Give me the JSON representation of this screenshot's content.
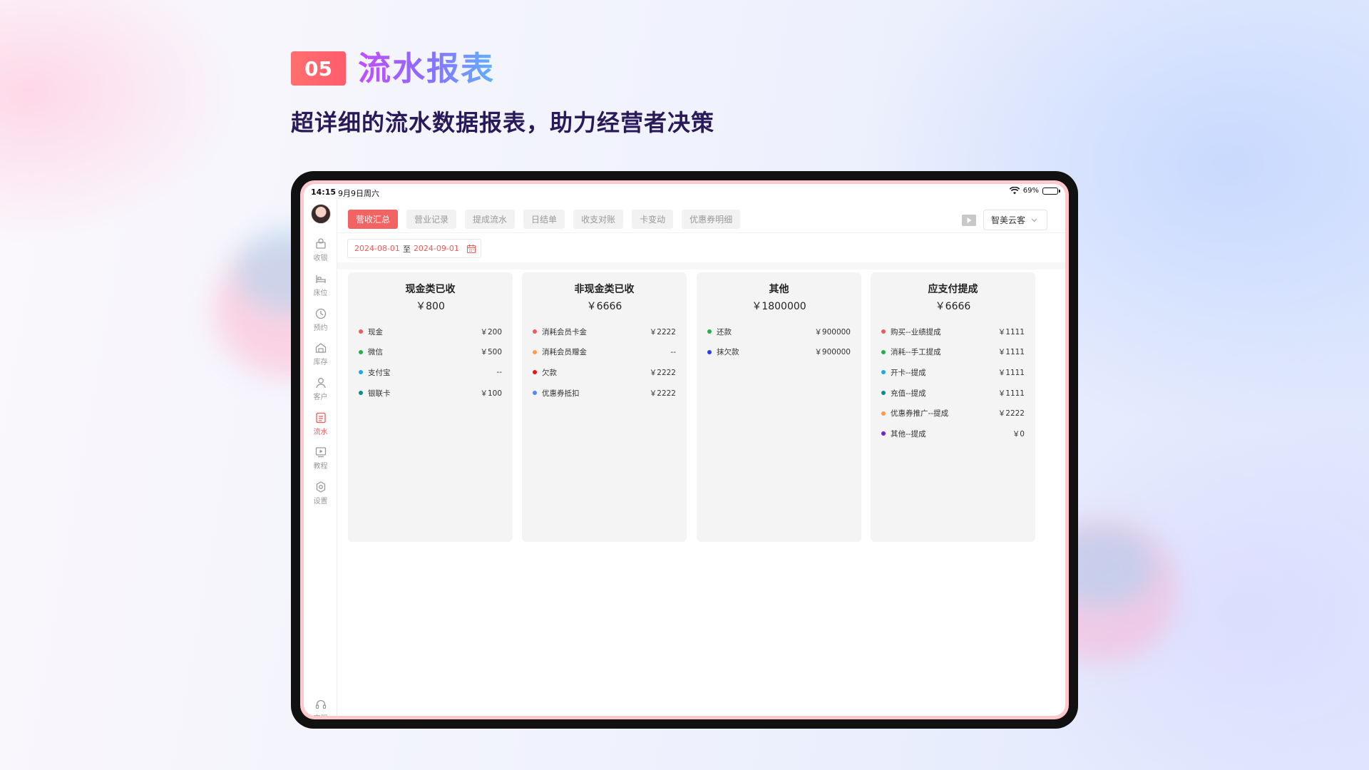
{
  "header": {
    "badge_number": "05",
    "title": "流水报表",
    "subtitle": "超详细的流水数据报表，助力经营者决策"
  },
  "status_bar": {
    "time": "14:15",
    "date": "9月9日周六",
    "battery": "69%"
  },
  "sidebar": {
    "items": [
      {
        "label": "收银",
        "icon": "cashier-icon"
      },
      {
        "label": "床位",
        "icon": "bed-icon"
      },
      {
        "label": "预约",
        "icon": "clock-icon"
      },
      {
        "label": "库存",
        "icon": "warehouse-icon"
      },
      {
        "label": "客户",
        "icon": "user-icon"
      },
      {
        "label": "流水",
        "icon": "ledger-icon",
        "active": true
      },
      {
        "label": "教程",
        "icon": "video-icon"
      },
      {
        "label": "设置",
        "icon": "gear-icon"
      }
    ],
    "service": {
      "label": "客服",
      "icon": "headset-icon"
    }
  },
  "tabs": [
    {
      "label": "营收汇总",
      "active": true
    },
    {
      "label": "营业记录"
    },
    {
      "label": "提成流水"
    },
    {
      "label": "日结单"
    },
    {
      "label": "收支对账"
    },
    {
      "label": "卡变动"
    },
    {
      "label": "优惠券明细"
    }
  ],
  "store_select": {
    "value": "智美云客"
  },
  "date_range": {
    "start": "2024-08-01",
    "separator": "至",
    "end": "2024-09-01"
  },
  "colors": {
    "accent": "#f26363",
    "red": "#f05a5a",
    "green": "#22b14c",
    "cyan": "#1ba9e8",
    "teal": "#0e8c8c",
    "orange": "#ff9a4a",
    "crimson": "#e81515",
    "blue": "#4a8cf0",
    "darkblue": "#2b3cf0",
    "purple": "#7a1ae0"
  },
  "cards": [
    {
      "title": "现金类已收",
      "total": "￥800",
      "items": [
        {
          "label": "现金",
          "amount": "￥200",
          "color": "#f05a5a"
        },
        {
          "label": "微信",
          "amount": "￥500",
          "color": "#22b14c"
        },
        {
          "label": "支付宝",
          "amount": "--",
          "color": "#1ba9e8"
        },
        {
          "label": "银联卡",
          "amount": "￥100",
          "color": "#0e8c8c"
        }
      ]
    },
    {
      "title": "非现金类已收",
      "total": "￥6666",
      "items": [
        {
          "label": "消耗会员卡金",
          "amount": "￥2222",
          "color": "#f05a5a"
        },
        {
          "label": "消耗会员赠金",
          "amount": "--",
          "color": "#ff9a4a"
        },
        {
          "label": "欠款",
          "amount": "￥2222",
          "color": "#e81515"
        },
        {
          "label": "优惠券抵扣",
          "amount": "￥2222",
          "color": "#4a8cf0"
        }
      ]
    },
    {
      "title": "其他",
      "total": "￥1800000",
      "items": [
        {
          "label": "还款",
          "amount": "￥900000",
          "color": "#22b14c"
        },
        {
          "label": "抹欠款",
          "amount": "￥900000",
          "color": "#2b3cf0"
        }
      ]
    },
    {
      "title": "应支付提成",
      "total": "￥6666",
      "items": [
        {
          "label": "购买--业绩提成",
          "amount": "￥1111",
          "color": "#f05a5a"
        },
        {
          "label": "消耗--手工提成",
          "amount": "￥1111",
          "color": "#22b14c"
        },
        {
          "label": "开卡--提成",
          "amount": "￥1111",
          "color": "#1ba9e8"
        },
        {
          "label": "充值--提成",
          "amount": "￥1111",
          "color": "#0e8c8c"
        },
        {
          "label": "优惠券推广--提成",
          "amount": "￥2222",
          "color": "#ff9a4a"
        },
        {
          "label": "其他--提成",
          "amount": "￥0",
          "color": "#7a1ae0"
        }
      ]
    }
  ]
}
